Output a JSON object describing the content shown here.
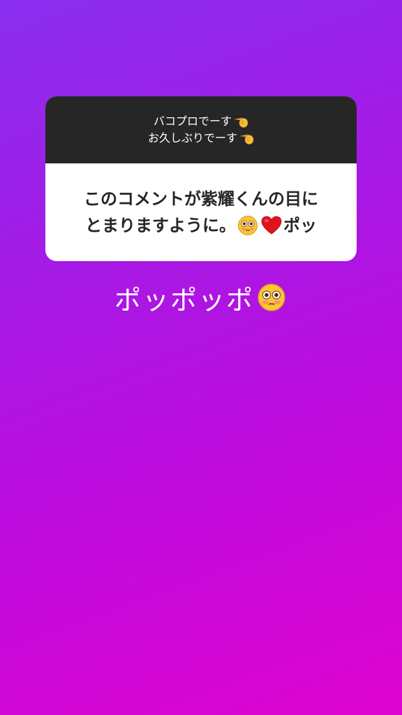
{
  "question_card": {
    "prompt_line_1": "バコプロでーす",
    "prompt_line_1_icon": "pointing-hand-icon",
    "prompt_line_2": "お久しぶりでーす",
    "prompt_line_2_icon": "pointing-hand-icon",
    "answer_line_1": "このコメントが紫耀くんの目に",
    "answer_line_2_text": "とまりますように。",
    "answer_line_2_emoji_1": "flushed-face-icon",
    "answer_line_2_emoji_2": "red-heart-icon",
    "answer_line_2_suffix": "ポッ"
  },
  "caption": {
    "text": "ポッポッポ",
    "emoji": "flushed-face-icon"
  },
  "colors": {
    "header_bg": "#262626",
    "body_bg": "#ffffff",
    "gradient_start": "#8a2ff0",
    "gradient_end": "#df04cf"
  }
}
